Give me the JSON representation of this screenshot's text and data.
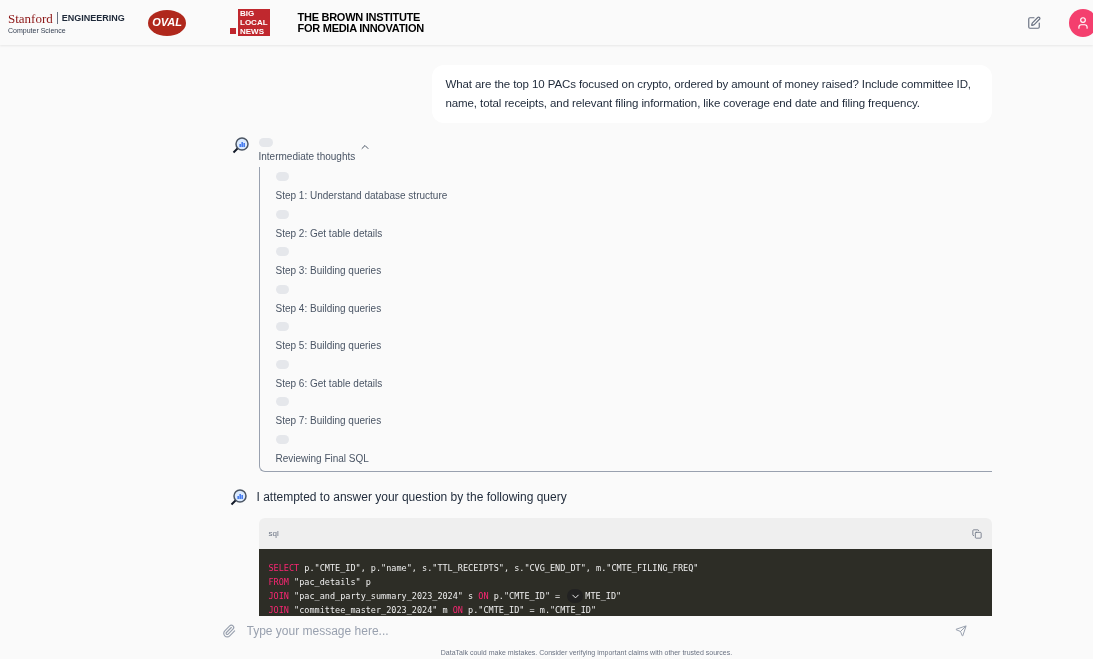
{
  "header": {
    "logos": {
      "stanford": {
        "name": "Stanford",
        "division": "ENGINEERING",
        "department": "Computer Science"
      },
      "oval": "OVAL",
      "big_local_news": [
        "BIG",
        "LOCAL",
        "NEWS"
      ],
      "brown": [
        "THE BROWN INSTITUTE",
        "FOR MEDIA INNOVATION"
      ]
    }
  },
  "user_message": "What are the top 10 PACs focused on crypto, ordered by amount of money raised? Include committee ID, name, total receipts, and relevant filing information, like coverage end date and filing frequency.",
  "thoughts": {
    "label": "Intermediate thoughts",
    "expanded": true,
    "steps": [
      {
        "label": "Step 1: Understand database structure"
      },
      {
        "label": "Step 2: Get table details"
      },
      {
        "label": "Step 3: Building queries"
      },
      {
        "label": "Step 4: Building queries"
      },
      {
        "label": "Step 5: Building queries"
      },
      {
        "label": "Step 6: Get table details"
      },
      {
        "label": "Step 7: Building queries"
      },
      {
        "label": "Reviewing Final SQL"
      }
    ]
  },
  "answer": {
    "text": "I attempted to answer your question by the following query",
    "code": {
      "language": "sql",
      "lines": [
        [
          {
            "kind": "keyword",
            "text": "SELECT"
          },
          {
            "kind": "plain",
            "text": " p.\"CMTE_ID\", p.\"name\", s.\"TTL_RECEIPTS\", s.\"CVG_END_DT\", m.\"CMTE_FILING_FREQ\""
          }
        ],
        [
          {
            "kind": "keyword",
            "text": "FROM"
          },
          {
            "kind": "plain",
            "text": " \"pac_details\" p"
          }
        ],
        [
          {
            "kind": "keyword",
            "text": "JOIN"
          },
          {
            "kind": "plain",
            "text": " \"pac_and_party_summary_2023_2024\" s "
          },
          {
            "kind": "keyword",
            "text": "ON"
          },
          {
            "kind": "plain",
            "text": " p.\"CMTE_ID\" = "
          },
          {
            "kind": "scroll_button"
          },
          {
            "kind": "plain",
            "text": "MTE_ID\""
          }
        ],
        [
          {
            "kind": "keyword",
            "text": "JOIN"
          },
          {
            "kind": "plain",
            "text": " \"committee_master_2023_2024\" m "
          },
          {
            "kind": "keyword",
            "text": "ON"
          },
          {
            "kind": "plain",
            "text": " p.\"CMTE_ID\" = m.\"CMTE_ID\""
          }
        ]
      ]
    }
  },
  "composer": {
    "placeholder": "Type your message here..."
  },
  "disclaimer": "DataTalk could make mistakes. Consider verifying important claims with other trusted sources."
}
